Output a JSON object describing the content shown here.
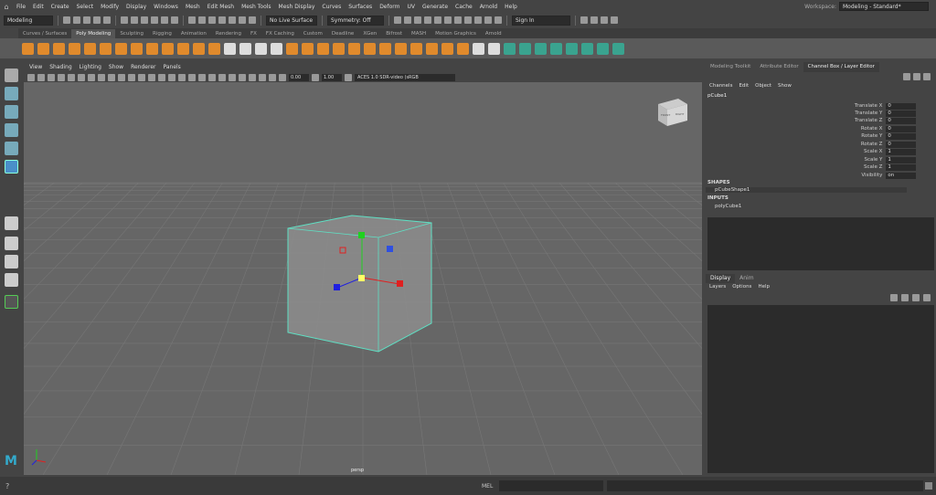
{
  "menubar": {
    "items": [
      "File",
      "Edit",
      "Create",
      "Select",
      "Modify",
      "Display",
      "Windows",
      "Mesh",
      "Edit Mesh",
      "Mesh Tools",
      "Mesh Display",
      "Curves",
      "Surfaces",
      "Deform",
      "UV",
      "Generate",
      "Cache",
      "Arnold",
      "Help"
    ],
    "workspace_label": "Workspace:",
    "workspace_value": "Modeling - Standard*"
  },
  "statusline": {
    "mode": "Modeling",
    "live_surface": "No Live Surface",
    "symmetry": "Symmetry: Off",
    "sign_in": "Sign In"
  },
  "shelf": {
    "tabs": [
      "Curves / Surfaces",
      "Poly Modeling",
      "Sculpting",
      "Rigging",
      "Animation",
      "Rendering",
      "FX",
      "FX Caching",
      "Custom",
      "Deadline",
      "XGen",
      "Bifrost",
      "MASH",
      "Motion Graphics",
      "Arnold"
    ],
    "active_tab": "Poly Modeling"
  },
  "viewport": {
    "menu": [
      "View",
      "Shading",
      "Lighting",
      "Show",
      "Renderer",
      "Panels"
    ],
    "exposure": "0.00",
    "gamma": "1.00",
    "color_space": "ACES 1.0 SDR-video (sRGB",
    "camera": "persp",
    "viewcube_front": "FRONT",
    "viewcube_right": "RIGHT"
  },
  "panel": {
    "tabs": [
      "Modeling Toolkit",
      "Attribute Editor",
      "Channel Box / Layer Editor"
    ],
    "active_tab": "Channel Box / Layer Editor",
    "channel_menu": [
      "Channels",
      "Edit",
      "Object",
      "Show"
    ],
    "object_name": "pCube1",
    "channels": [
      {
        "name": "Translate X",
        "value": "0"
      },
      {
        "name": "Translate Y",
        "value": "0"
      },
      {
        "name": "Translate Z",
        "value": "0"
      },
      {
        "name": "Rotate X",
        "value": "0"
      },
      {
        "name": "Rotate Y",
        "value": "0"
      },
      {
        "name": "Rotate Z",
        "value": "0"
      },
      {
        "name": "Scale X",
        "value": "1"
      },
      {
        "name": "Scale Y",
        "value": "1"
      },
      {
        "name": "Scale Z",
        "value": "1"
      },
      {
        "name": "Visibility",
        "value": "on"
      }
    ],
    "shapes_label": "SHAPES",
    "shape_name": "pCubeShape1",
    "inputs_label": "INPUTS",
    "input_name": "polyCube1",
    "layer_tabs": [
      "Display",
      "Anim"
    ],
    "layer_menu": [
      "Layers",
      "Options",
      "Help"
    ]
  },
  "cmdline": {
    "lang": "MEL"
  },
  "colors": {
    "accent": "#5fe0c4",
    "x_axis": "#e02020",
    "y_axis": "#20d020",
    "z_axis": "#2020e0"
  }
}
